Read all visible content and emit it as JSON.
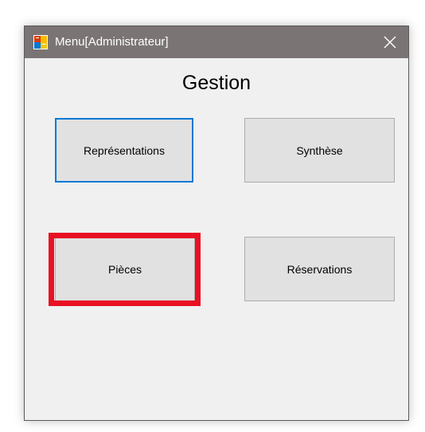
{
  "window": {
    "title": "Menu[Administrateur]",
    "icon": "form-app-icon",
    "close_icon": "close-icon"
  },
  "main": {
    "heading": "Gestion",
    "buttons": {
      "representations": "Représentations",
      "synthese": "Synthèse",
      "pieces": "Pièces",
      "reservations": "Réservations"
    }
  },
  "colors": {
    "titlebar": "#7a7574",
    "focus_border": "#0078d7",
    "highlight": "#e81123"
  }
}
